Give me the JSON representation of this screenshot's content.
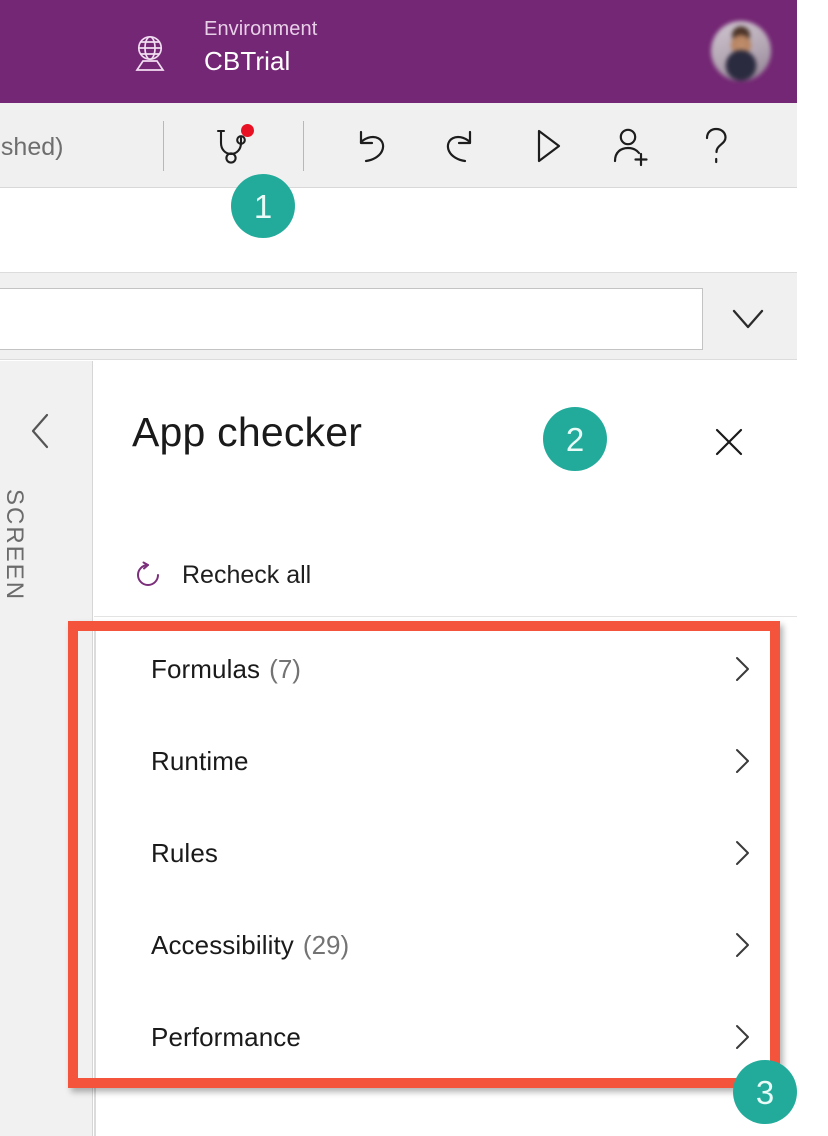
{
  "topbar": {
    "globe_icon": "globe-icon",
    "environment_label": "Environment",
    "environment_name": "CBTrial",
    "avatar_icon": "user-avatar"
  },
  "commandbar": {
    "app_status": "ublished)",
    "buttons": [
      {
        "name": "app-checker",
        "icon": "stethoscope-icon",
        "has_alert_dot": true
      },
      {
        "name": "undo",
        "icon": "undo-arrow-icon"
      },
      {
        "name": "redo",
        "icon": "redo-arrow-icon"
      },
      {
        "name": "preview",
        "icon": "play-triangle-icon"
      },
      {
        "name": "share",
        "icon": "person-add-icon"
      },
      {
        "name": "help",
        "icon": "question-mark-icon"
      }
    ]
  },
  "formula_bar": {
    "value": "",
    "placeholder": "",
    "expand_icon": "chevron-down-icon"
  },
  "left_rail": {
    "back_icon": "chevron-left-icon",
    "section_label": "SCREEN"
  },
  "app_checker": {
    "title": "App checker",
    "close_icon": "close-x-icon",
    "recheck": {
      "icon": "refresh-icon",
      "label": "Recheck all"
    },
    "items": [
      {
        "label": "Formulas",
        "count": "(7)",
        "chevron": "chevron-right-icon"
      },
      {
        "label": "Runtime",
        "count": "",
        "chevron": "chevron-right-icon"
      },
      {
        "label": "Rules",
        "count": "",
        "chevron": "chevron-right-icon"
      },
      {
        "label": "Accessibility",
        "count": "(29)",
        "chevron": "chevron-right-icon"
      },
      {
        "label": "Performance",
        "count": "",
        "chevron": "chevron-right-icon"
      }
    ]
  },
  "annotations": {
    "badge_color": "#22ab9b",
    "highlight_color": "#f4533c",
    "steps": [
      {
        "number": "1"
      },
      {
        "number": "2"
      },
      {
        "number": "3"
      }
    ]
  }
}
